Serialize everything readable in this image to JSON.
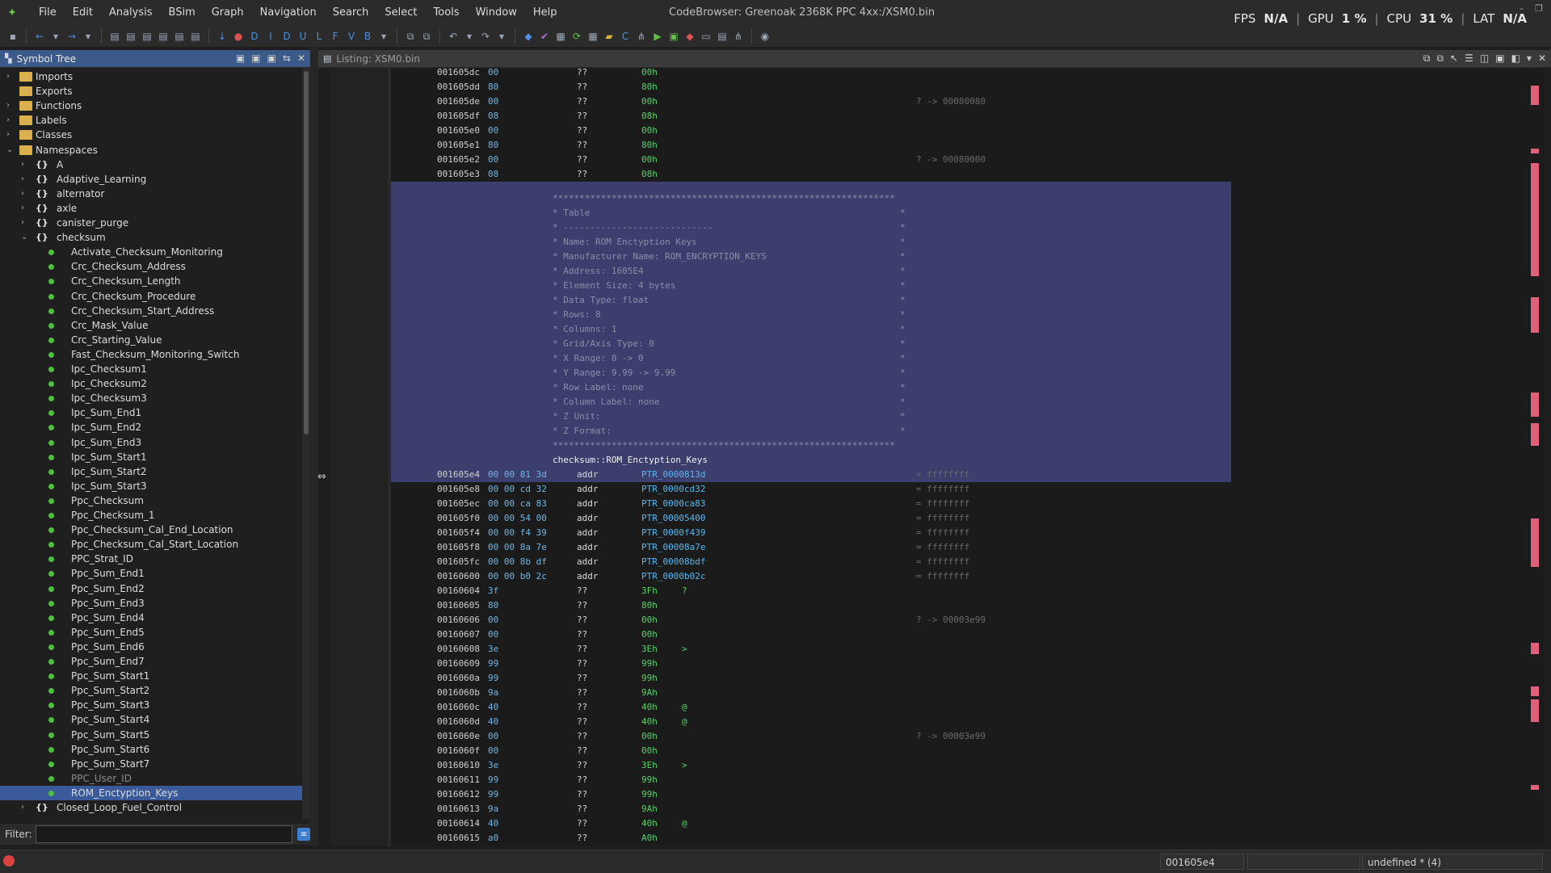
{
  "menubar": {
    "items": [
      "File",
      "Edit",
      "Analysis",
      "BSim",
      "Graph",
      "Navigation",
      "Search",
      "Select",
      "Tools",
      "Window",
      "Help"
    ],
    "window_title": "CodeBrowser: Greenoak 2368K PPC 4xx:/XSM0.bin"
  },
  "stats": {
    "fps_label": "FPS",
    "fps_value": "N/A",
    "gpu_label": "GPU",
    "gpu_value": "1 %",
    "cpu_label": "CPU",
    "cpu_value": "31 %",
    "lat_label": "LAT",
    "lat_value": "N/A"
  },
  "symbol_tree": {
    "title": "Symbol Tree",
    "filter_label": "Filter:",
    "filter_value": "",
    "rows": [
      {
        "label": "Imports",
        "level": 0,
        "kind": "folder",
        "expand": "right"
      },
      {
        "label": "Exports",
        "level": 0,
        "kind": "folder",
        "expand": ""
      },
      {
        "label": "Functions",
        "level": 0,
        "kind": "folder",
        "expand": "right"
      },
      {
        "label": "Labels",
        "level": 0,
        "kind": "folder",
        "expand": "right"
      },
      {
        "label": "Classes",
        "level": 0,
        "kind": "folder",
        "expand": "right"
      },
      {
        "label": "Namespaces",
        "level": 0,
        "kind": "folder",
        "expand": "down"
      },
      {
        "label": "A",
        "level": 1,
        "kind": "ns",
        "expand": "right"
      },
      {
        "label": "Adaptive_Learning",
        "level": 1,
        "kind": "ns",
        "expand": "right"
      },
      {
        "label": "alternator",
        "level": 1,
        "kind": "ns",
        "expand": "right"
      },
      {
        "label": "axle",
        "level": 1,
        "kind": "ns",
        "expand": "right"
      },
      {
        "label": "canister_purge",
        "level": 1,
        "kind": "ns",
        "expand": "right"
      },
      {
        "label": "checksum",
        "level": 1,
        "kind": "ns",
        "expand": "down"
      },
      {
        "label": "Activate_Checksum_Monitoring",
        "level": 2,
        "kind": "dot"
      },
      {
        "label": "Crc_Checksum_Address",
        "level": 2,
        "kind": "dot"
      },
      {
        "label": "Crc_Checksum_Length",
        "level": 2,
        "kind": "dot"
      },
      {
        "label": "Crc_Checksum_Procedure",
        "level": 2,
        "kind": "dot"
      },
      {
        "label": "Crc_Checksum_Start_Address",
        "level": 2,
        "kind": "dot"
      },
      {
        "label": "Crc_Mask_Value",
        "level": 2,
        "kind": "dot"
      },
      {
        "label": "Crc_Starting_Value",
        "level": 2,
        "kind": "dot"
      },
      {
        "label": "Fast_Checksum_Monitoring_Switch",
        "level": 2,
        "kind": "dot"
      },
      {
        "label": "Ipc_Checksum1",
        "level": 2,
        "kind": "dot"
      },
      {
        "label": "Ipc_Checksum2",
        "level": 2,
        "kind": "dot"
      },
      {
        "label": "Ipc_Checksum3",
        "level": 2,
        "kind": "dot"
      },
      {
        "label": "Ipc_Sum_End1",
        "level": 2,
        "kind": "dot"
      },
      {
        "label": "Ipc_Sum_End2",
        "level": 2,
        "kind": "dot"
      },
      {
        "label": "Ipc_Sum_End3",
        "level": 2,
        "kind": "dot"
      },
      {
        "label": "Ipc_Sum_Start1",
        "level": 2,
        "kind": "dot"
      },
      {
        "label": "Ipc_Sum_Start2",
        "level": 2,
        "kind": "dot"
      },
      {
        "label": "Ipc_Sum_Start3",
        "level": 2,
        "kind": "dot"
      },
      {
        "label": "Ppc_Checksum",
        "level": 2,
        "kind": "dot"
      },
      {
        "label": "Ppc_Checksum_1",
        "level": 2,
        "kind": "dot"
      },
      {
        "label": "Ppc_Checksum_Cal_End_Location",
        "level": 2,
        "kind": "dot"
      },
      {
        "label": "Ppc_Checksum_Cal_Start_Location",
        "level": 2,
        "kind": "dot"
      },
      {
        "label": "PPC_Strat_ID",
        "level": 2,
        "kind": "dot"
      },
      {
        "label": "Ppc_Sum_End1",
        "level": 2,
        "kind": "dot"
      },
      {
        "label": "Ppc_Sum_End2",
        "level": 2,
        "kind": "dot"
      },
      {
        "label": "Ppc_Sum_End3",
        "level": 2,
        "kind": "dot"
      },
      {
        "label": "Ppc_Sum_End4",
        "level": 2,
        "kind": "dot"
      },
      {
        "label": "Ppc_Sum_End5",
        "level": 2,
        "kind": "dot"
      },
      {
        "label": "Ppc_Sum_End6",
        "level": 2,
        "kind": "dot"
      },
      {
        "label": "Ppc_Sum_End7",
        "level": 2,
        "kind": "dot"
      },
      {
        "label": "Ppc_Sum_Start1",
        "level": 2,
        "kind": "dot"
      },
      {
        "label": "Ppc_Sum_Start2",
        "level": 2,
        "kind": "dot"
      },
      {
        "label": "Ppc_Sum_Start3",
        "level": 2,
        "kind": "dot"
      },
      {
        "label": "Ppc_Sum_Start4",
        "level": 2,
        "kind": "dot"
      },
      {
        "label": "Ppc_Sum_Start5",
        "level": 2,
        "kind": "dot"
      },
      {
        "label": "Ppc_Sum_Start6",
        "level": 2,
        "kind": "dot"
      },
      {
        "label": "Ppc_Sum_Start7",
        "level": 2,
        "kind": "dot"
      },
      {
        "label": "PPC_User_ID",
        "level": 2,
        "kind": "dot",
        "dim": true
      },
      {
        "label": "ROM_Enctyption_Keys",
        "level": 2,
        "kind": "dot",
        "selected": true
      },
      {
        "label": "Closed_Loop_Fuel_Control",
        "level": 1,
        "kind": "ns",
        "expand": "right"
      }
    ]
  },
  "listing": {
    "title": "Listing:  XSM0.bin",
    "rows_top": [
      {
        "addr": "001605dc",
        "bytes": "00",
        "mn": "??",
        "op": "00h",
        "cmt": ""
      },
      {
        "addr": "001605dd",
        "bytes": "80",
        "mn": "??",
        "op": "80h",
        "cmt": ""
      },
      {
        "addr": "001605de",
        "bytes": "00",
        "mn": "??",
        "op": "00h",
        "cmt": "?  ->  00080080"
      },
      {
        "addr": "001605df",
        "bytes": "08",
        "mn": "??",
        "op": "08h",
        "cmt": ""
      },
      {
        "addr": "001605e0",
        "bytes": "00",
        "mn": "??",
        "op": "00h",
        "cmt": ""
      },
      {
        "addr": "001605e1",
        "bytes": "80",
        "mn": "??",
        "op": "80h",
        "cmt": ""
      },
      {
        "addr": "001605e2",
        "bytes": "00",
        "mn": "??",
        "op": "00h",
        "cmt": "?  ->  00080000"
      },
      {
        "addr": "001605e3",
        "bytes": "08",
        "mn": "??",
        "op": "08h",
        "cmt": ""
      }
    ],
    "plate_lines": [
      "****************************************************************",
      "* Table",
      "* ----------------------------",
      "* Name: ROM Enctyption Keys",
      "* Manufacturer Name: ROM_ENCRYPTION_KEYS",
      "* Address: 1605E4",
      "* Element Size: 4 bytes",
      "* Data Type: float",
      "* Rows: 8",
      "* Columns: 1",
      "* Grid/Axis Type: 0",
      "* X Range: 0 -> 0",
      "* Y Range: 9.99 -> 9.99",
      "* Row Label: none",
      "* Column Label: none",
      "* Z Unit:",
      "* Z Format:",
      "****************************************************************"
    ],
    "plate_right_star": "*",
    "label": "checksum::ROM_Enctyption_Keys",
    "rows_addr": [
      {
        "addr": "001605e4",
        "bytes": "00 00 81 3d",
        "mn": "addr",
        "op": "PTR_0000813d",
        "cmt": "=  ffffffff"
      },
      {
        "addr": "001605e8",
        "bytes": "00 00 cd 32",
        "mn": "addr",
        "op": "PTR_0000cd32",
        "cmt": "=  ffffffff"
      },
      {
        "addr": "001605ec",
        "bytes": "00 00 ca 83",
        "mn": "addr",
        "op": "PTR_0000ca83",
        "cmt": "=  ffffffff"
      },
      {
        "addr": "001605f0",
        "bytes": "00 00 54 00",
        "mn": "addr",
        "op": "PTR_00005400",
        "cmt": "=  ffffffff"
      },
      {
        "addr": "001605f4",
        "bytes": "00 00 f4 39",
        "mn": "addr",
        "op": "PTR_0000f439",
        "cmt": "=  ffffffff"
      },
      {
        "addr": "001605f8",
        "bytes": "00 00 8a 7e",
        "mn": "addr",
        "op": "PTR_00008a7e",
        "cmt": "=  ffffffff"
      },
      {
        "addr": "001605fc",
        "bytes": "00 00 8b df",
        "mn": "addr",
        "op": "PTR_00008bdf",
        "cmt": "=  ffffffff"
      },
      {
        "addr": "00160600",
        "bytes": "00 00 b0 2c",
        "mn": "addr",
        "op": "PTR_0000b02c",
        "cmt": "=  ffffffff"
      }
    ],
    "rows_bottom": [
      {
        "addr": "00160604",
        "bytes": "3f",
        "mn": "??",
        "op": "3Fh",
        "ch": "?",
        "cmt": ""
      },
      {
        "addr": "00160605",
        "bytes": "80",
        "mn": "??",
        "op": "80h",
        "ch": "",
        "cmt": ""
      },
      {
        "addr": "00160606",
        "bytes": "00",
        "mn": "??",
        "op": "00h",
        "ch": "",
        "cmt": "?  ->  00003e99"
      },
      {
        "addr": "00160607",
        "bytes": "00",
        "mn": "??",
        "op": "00h",
        "ch": "",
        "cmt": ""
      },
      {
        "addr": "00160608",
        "bytes": "3e",
        "mn": "??",
        "op": "3Eh",
        "ch": ">",
        "cmt": ""
      },
      {
        "addr": "00160609",
        "bytes": "99",
        "mn": "??",
        "op": "99h",
        "ch": "",
        "cmt": ""
      },
      {
        "addr": "0016060a",
        "bytes": "99",
        "mn": "??",
        "op": "99h",
        "ch": "",
        "cmt": ""
      },
      {
        "addr": "0016060b",
        "bytes": "9a",
        "mn": "??",
        "op": "9Ah",
        "ch": "",
        "cmt": ""
      },
      {
        "addr": "0016060c",
        "bytes": "40",
        "mn": "??",
        "op": "40h",
        "ch": "@",
        "cmt": ""
      },
      {
        "addr": "0016060d",
        "bytes": "40",
        "mn": "??",
        "op": "40h",
        "ch": "@",
        "cmt": ""
      },
      {
        "addr": "0016060e",
        "bytes": "00",
        "mn": "??",
        "op": "00h",
        "ch": "",
        "cmt": "?  ->  00003e99"
      },
      {
        "addr": "0016060f",
        "bytes": "00",
        "mn": "??",
        "op": "00h",
        "ch": "",
        "cmt": ""
      },
      {
        "addr": "00160610",
        "bytes": "3e",
        "mn": "??",
        "op": "3Eh",
        "ch": ">",
        "cmt": ""
      },
      {
        "addr": "00160611",
        "bytes": "99",
        "mn": "??",
        "op": "99h",
        "ch": "",
        "cmt": ""
      },
      {
        "addr": "00160612",
        "bytes": "99",
        "mn": "??",
        "op": "99h",
        "ch": "",
        "cmt": ""
      },
      {
        "addr": "00160613",
        "bytes": "9a",
        "mn": "??",
        "op": "9Ah",
        "ch": "",
        "cmt": ""
      },
      {
        "addr": "00160614",
        "bytes": "40",
        "mn": "??",
        "op": "40h",
        "ch": "@",
        "cmt": ""
      },
      {
        "addr": "00160615",
        "bytes": "a0",
        "mn": "??",
        "op": "A0h",
        "ch": "",
        "cmt": ""
      }
    ]
  },
  "statusbar": {
    "address": "001605e4",
    "field2": "",
    "type": "undefined * (4)"
  },
  "colors": {
    "plate_bg": "#3c3e6e",
    "selected_row": "#3b5a9a",
    "bytes": "#6cb7e8",
    "operand": "#58d36a"
  }
}
